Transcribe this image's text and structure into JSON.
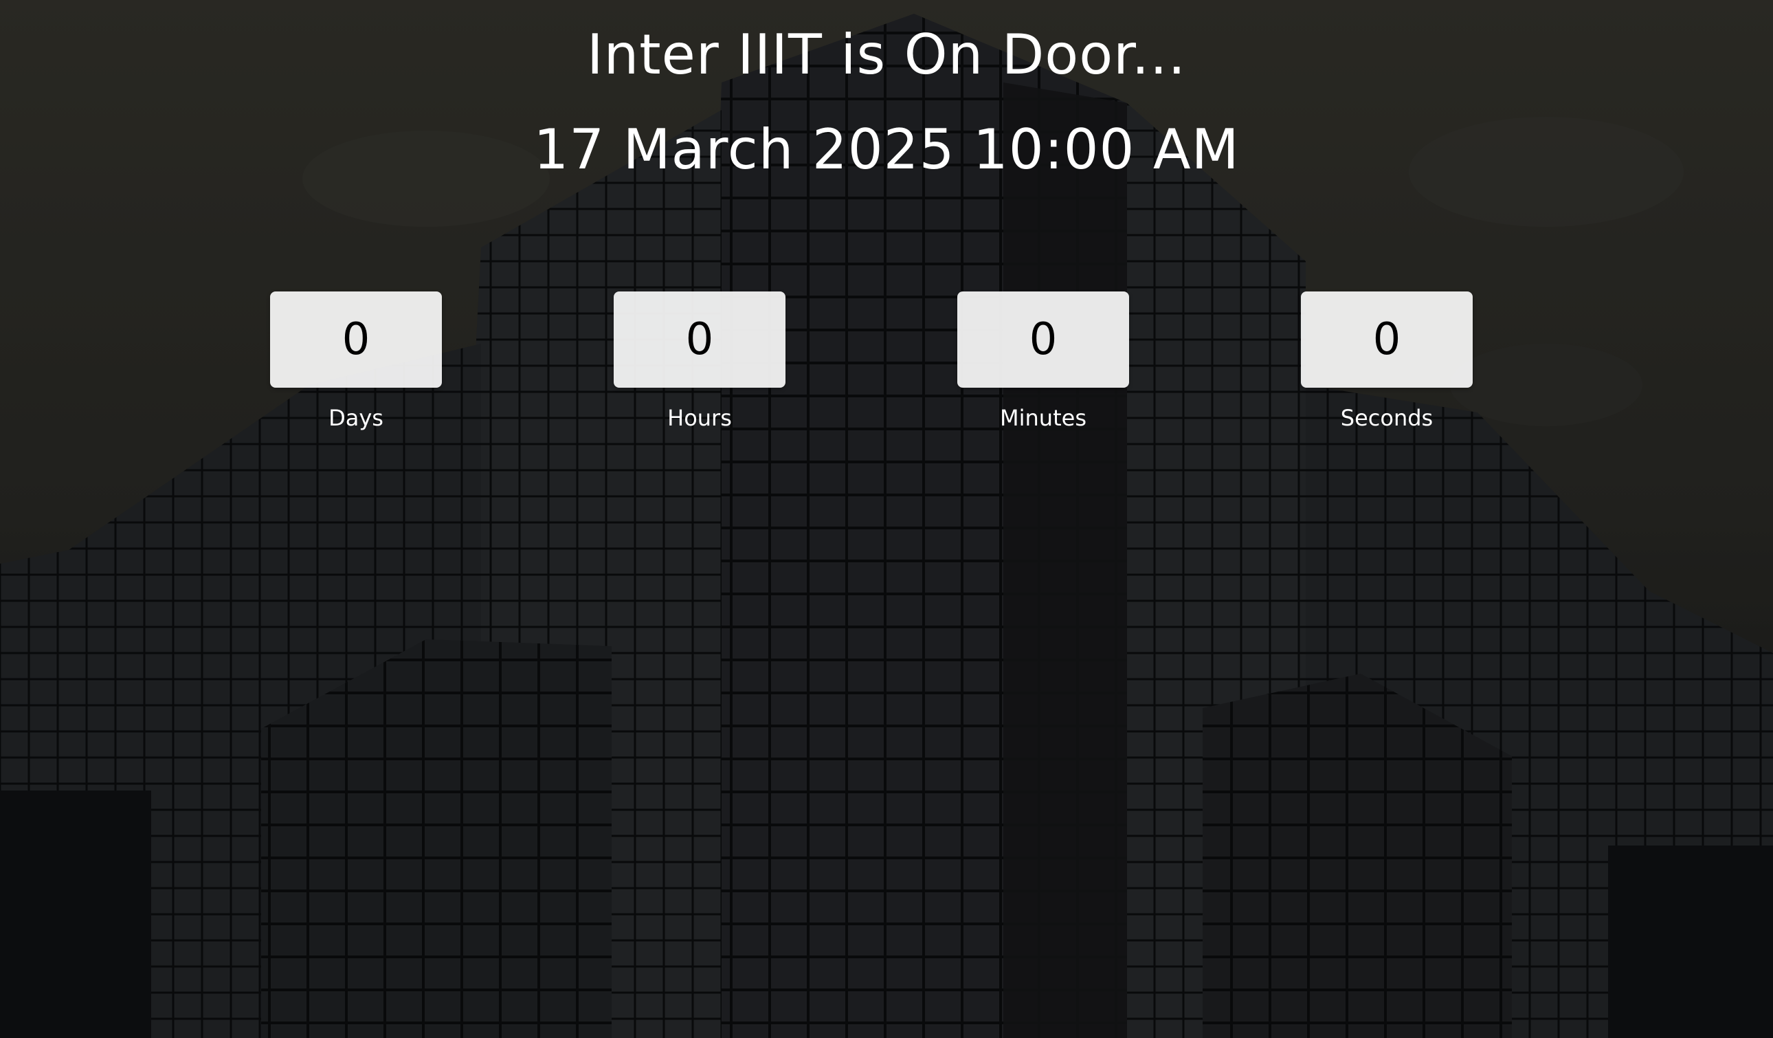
{
  "header": {
    "title": "Inter IIIT is On Door...",
    "event_datetime": "17 March 2025 10:00 AM"
  },
  "countdown": {
    "days": {
      "value": "0",
      "label": "Days"
    },
    "hours": {
      "value": "0",
      "label": "Hours"
    },
    "minutes": {
      "value": "0",
      "label": "Minutes"
    },
    "seconds": {
      "value": "0",
      "label": "Seconds"
    }
  },
  "colors": {
    "text": "#ffffff",
    "box_background": "#f2f2f2",
    "box_text": "#000000",
    "overlay": "#1a1a1a"
  }
}
